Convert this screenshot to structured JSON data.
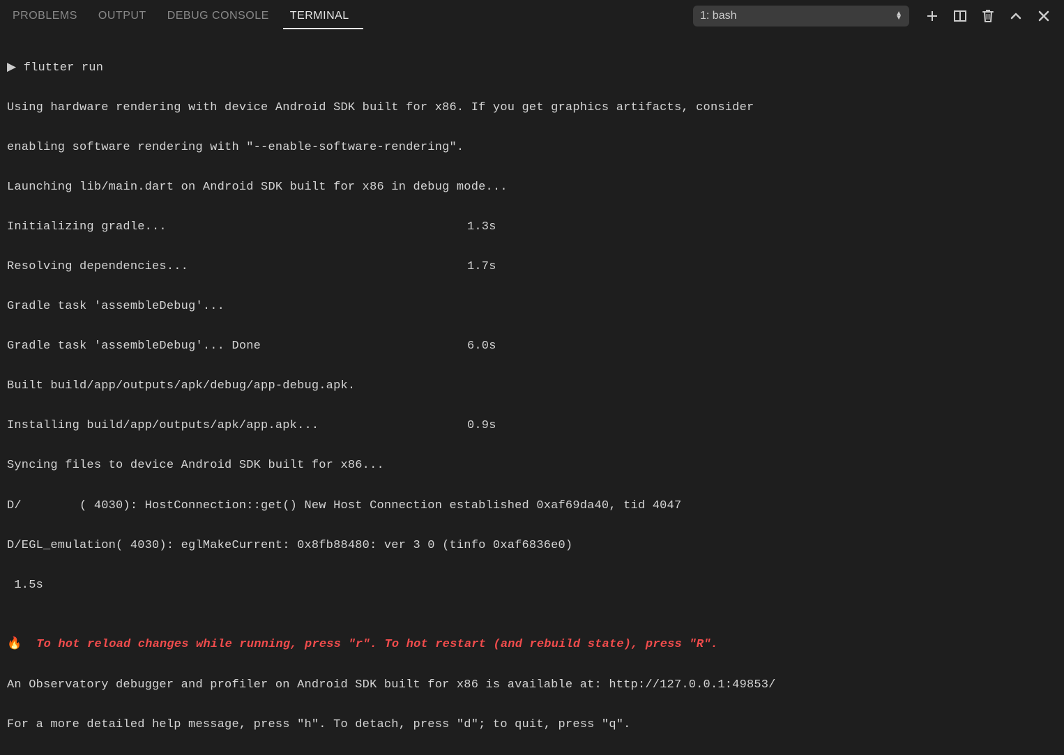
{
  "tabs": {
    "problems": "PROBLEMS",
    "output": "OUTPUT",
    "debug_console": "DEBUG CONSOLE",
    "terminal": "TERMINAL"
  },
  "dropdown": {
    "selected": "1: bash"
  },
  "terminal": {
    "prompt": "▶",
    "command": "flutter run",
    "line_hw1": "Using hardware rendering with device Android SDK built for x86. If you get graphics artifacts, consider",
    "line_hw2": "enabling software rendering with \"--enable-software-rendering\".",
    "line_launch": "Launching lib/main.dart on Android SDK built for x86 in debug mode...",
    "init_gradle_label": "Initializing gradle...",
    "init_gradle_time": "1.3s",
    "resolving_label": "Resolving dependencies...",
    "resolving_time": "1.7s",
    "gradle1": "Gradle task 'assembleDebug'...",
    "gradle2_label": "Gradle task 'assembleDebug'... Done",
    "gradle2_time": "6.0s",
    "built": "Built build/app/outputs/apk/debug/app-debug.apk.",
    "installing_label": "Installing build/app/outputs/apk/app.apk...",
    "installing_time": "0.9s",
    "syncing": "Syncing files to device Android SDK built for x86...",
    "log1": "D/        ( 4030): HostConnection::get() New Host Connection established 0xaf69da40, tid 4047",
    "log2": "D/EGL_emulation( 4030): eglMakeCurrent: 0x8fb88480: ver 3 0 (tinfo 0xaf6836e0)",
    "sync_time": " 1.5s",
    "blank": "",
    "fire": "🔥 ",
    "hot_reload": " To hot reload changes while running, press \"r\". To hot restart (and rebuild state), press \"R\".",
    "observatory": "An Observatory debugger and profiler on Android SDK built for x86 is available at: http://127.0.0.1:49853/",
    "help": "For a more detailed help message, press \"h\". To detach, press \"d\"; to quit, press \"q\"."
  }
}
